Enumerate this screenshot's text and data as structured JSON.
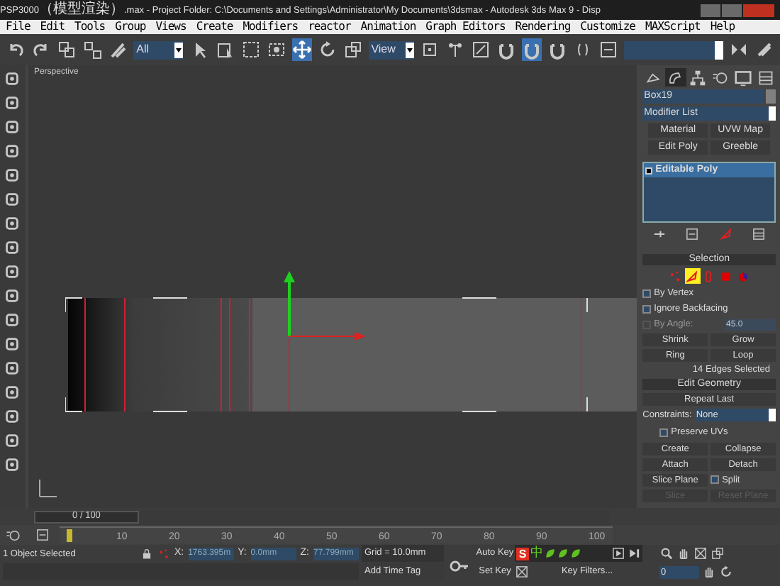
{
  "window": {
    "title": "PSP3000（模型渲染）.max  - Project Folder: C:\\Documents and Settings\\Administrator\\My Documents\\3dsmax  - Autodesk 3ds Max 9  - Disp"
  },
  "menu": [
    "File",
    "Edit",
    "Tools",
    "Group",
    "Views",
    "Create",
    "Modifiers",
    "reactor",
    "Animation",
    "Graph Editors",
    "Rendering",
    "Customize",
    "MAXScript",
    "Help"
  ],
  "toolbar": {
    "tools": [
      {
        "kind": "undo",
        "selected": false
      },
      {
        "kind": "redo",
        "selected": false
      },
      {
        "kind": "link",
        "selected": false
      },
      {
        "kind": "unlink",
        "selected": false
      },
      {
        "kind": "bind",
        "selected": false
      },
      {
        "kind": "filter",
        "value": "All"
      },
      {
        "kind": "arrow",
        "selected": false
      },
      {
        "kind": "byname",
        "selected": false
      },
      {
        "kind": "region",
        "selected": false
      },
      {
        "kind": "window",
        "selected": false
      },
      {
        "kind": "move",
        "selected": true
      },
      {
        "kind": "rotate",
        "selected": false
      },
      {
        "kind": "scale",
        "selected": false
      },
      {
        "kind": "coord",
        "value": "View"
      },
      {
        "kind": "pivot",
        "selected": false
      },
      {
        "kind": "manip",
        "selected": false
      },
      {
        "kind": "keyb",
        "selected": false
      },
      {
        "kind": "snap",
        "selected": false
      },
      {
        "kind": "anglesnap",
        "selected": true
      },
      {
        "kind": "percent",
        "selected": false
      },
      {
        "kind": "spinner",
        "selected": false
      },
      {
        "kind": "editsel",
        "selected": false
      },
      {
        "kind": "named"
      },
      {
        "kind": "mirror",
        "selected": false
      },
      {
        "kind": "align",
        "selected": false
      }
    ]
  },
  "viewport": {
    "label": "Perspective"
  },
  "command_panel": {
    "tabs": [
      {
        "kind": "create",
        "selected": false
      },
      {
        "kind": "modify",
        "selected": true
      },
      {
        "kind": "hierarchy",
        "selected": false
      },
      {
        "kind": "motion",
        "selected": false
      },
      {
        "kind": "display",
        "selected": false
      },
      {
        "kind": "utilities",
        "selected": false
      }
    ],
    "object_name": "Box19",
    "modifier_list": "Modifier List",
    "modifier_buttons": [
      "Material",
      "UVW Map",
      "Edit Poly",
      "Greeble"
    ],
    "stack": [
      {
        "label": "Editable Poly",
        "selected": true
      }
    ],
    "selection": {
      "title": "Selection",
      "subobjects": [
        {
          "kind": "vertex",
          "selected": false
        },
        {
          "kind": "edge",
          "selected": true
        },
        {
          "kind": "border",
          "selected": false
        },
        {
          "kind": "polygon",
          "selected": false
        },
        {
          "kind": "element",
          "selected": false
        }
      ],
      "options": [
        {
          "label": "By Vertex",
          "checked": false,
          "disabled": false
        },
        {
          "label": "Ignore Backfacing",
          "checked": false,
          "disabled": false
        },
        {
          "label": "By Angle:",
          "checked": false,
          "disabled": true,
          "value": "45.0"
        }
      ],
      "shrink": "Shrink",
      "grow": "Grow",
      "ring": "Ring",
      "loop": "Loop",
      "status": "14 Edges Selected"
    },
    "edit_geometry": {
      "title": "Edit Geometry",
      "repeat": "Repeat Last",
      "constraints_label": "Constraints:",
      "constraints": "None",
      "preserve_uvs": {
        "label": "Preserve UVs",
        "checked": false
      },
      "buttons": [
        {
          "label": "Create",
          "disabled": false
        },
        {
          "label": "Collapse",
          "disabled": false
        },
        {
          "label": "Attach",
          "disabled": false
        },
        {
          "label": "Detach",
          "disabled": false
        }
      ],
      "slice_plane": "Slice Plane",
      "split": {
        "label": "Split",
        "checked": false
      },
      "slice": {
        "label": "Slice",
        "disabled": true
      },
      "reset_plane": {
        "label": "Reset Plane",
        "disabled": true
      }
    }
  },
  "timeline": {
    "frame": "0 / 100",
    "level": 0,
    "ticks": [
      "10",
      "20",
      "30",
      "40",
      "50",
      "60",
      "70",
      "80",
      "90",
      "100"
    ]
  },
  "status_bar": {
    "selection": "1 Object Selected",
    "coordinates": [
      {
        "axis": "X:",
        "value": "1763.395m"
      },
      {
        "axis": "Y:",
        "value": "0.0mm"
      },
      {
        "axis": "Z:",
        "value": "77.799mm"
      }
    ],
    "grid": "Grid = 10.0mm",
    "add_time_tag": "Add Time Tag",
    "auto_key": "Auto Key",
    "set_key": "Set Key",
    "key_filters": "Key Filters...",
    "frame": "0",
    "ime": [
      "S",
      "中"
    ]
  }
}
